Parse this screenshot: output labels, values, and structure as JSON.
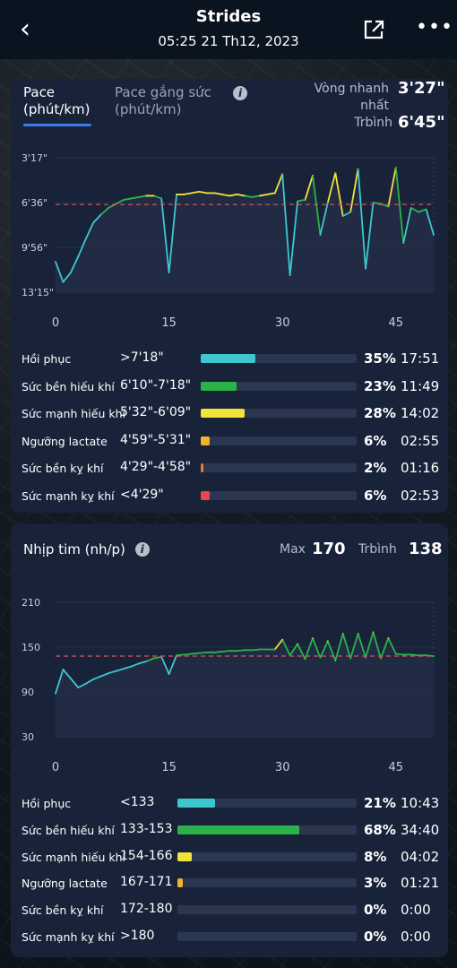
{
  "header": {
    "title": "Strides",
    "datetime": "05:25 21 Th12, 2023"
  },
  "pace": {
    "tab_active": "Pace (phút/km)",
    "tab_inactive": "Pace gắng sức (phút/km)",
    "fastest_label": "Vòng nhanh nhất",
    "fastest_value": "3'27\"",
    "avg_label": "Trbình",
    "avg_value": "6'45\"",
    "chart_y_ticks": [
      "3'17\"",
      "6'36\"",
      "9'56\"",
      "13'15\""
    ],
    "chart_x_ticks": [
      "0",
      "15",
      "30",
      "45"
    ],
    "zones": [
      {
        "name": "Hồi phục",
        "range": ">7'18\"",
        "percent": "35%",
        "time": "17:51",
        "fraction": 0.35,
        "color": "#3fc7cf"
      },
      {
        "name": "Sức bền hiếu khí",
        "range": "6'10\"-7'18\"",
        "percent": "23%",
        "time": "11:49",
        "fraction": 0.23,
        "color": "#2bb34a"
      },
      {
        "name": "Sức mạnh hiếu khí",
        "range": "5'32\"-6'09\"",
        "percent": "28%",
        "time": "14:02",
        "fraction": 0.28,
        "color": "#f1e33a"
      },
      {
        "name": "Ngưỡng lactate",
        "range": "4'59\"-5'31\"",
        "percent": "6%",
        "time": "02:55",
        "fraction": 0.06,
        "color": "#f3b12c"
      },
      {
        "name": "Sức bền kỵ khí",
        "range": "4'29\"-4'58\"",
        "percent": "2%",
        "time": "01:16",
        "fraction": 0.02,
        "color": "#ef7a32"
      },
      {
        "name": "Sức mạnh kỵ khí",
        "range": "<4'29\"",
        "percent": "6%",
        "time": "02:53",
        "fraction": 0.06,
        "color": "#e8474f"
      }
    ]
  },
  "hr": {
    "title": "Nhịp tim (nh/p)",
    "max_label": "Max",
    "max_value": "170",
    "avg_label": "Trbình",
    "avg_value": "138",
    "chart_y_ticks": [
      "210",
      "150",
      "90",
      "30"
    ],
    "chart_x_ticks": [
      "0",
      "15",
      "30",
      "45"
    ],
    "zones": [
      {
        "name": "Hồi phục",
        "range": "<133",
        "percent": "21%",
        "time": "10:43",
        "fraction": 0.21,
        "color": "#3fc7cf"
      },
      {
        "name": "Sức bền hiếu khí",
        "range": "133-153",
        "percent": "68%",
        "time": "34:40",
        "fraction": 0.68,
        "color": "#2bb34a"
      },
      {
        "name": "Sức mạnh hiếu khí",
        "range": "154-166",
        "percent": "8%",
        "time": "04:02",
        "fraction": 0.08,
        "color": "#f1e33a"
      },
      {
        "name": "Ngưỡng lactate",
        "range": "167-171",
        "percent": "3%",
        "time": "01:21",
        "fraction": 0.03,
        "color": "#f3b12c"
      },
      {
        "name": "Sức bền kỵ khí",
        "range": "172-180",
        "percent": "0%",
        "time": "0:00",
        "fraction": 0,
        "color": "#ef7a32"
      },
      {
        "name": "Sức mạnh kỵ khí",
        "range": ">180",
        "percent": "0%",
        "time": "0:00",
        "fraction": 0,
        "color": "#e8474f"
      }
    ]
  },
  "chart_data": [
    {
      "type": "line",
      "ylabel": "",
      "xlabel": "",
      "y_reversed": true,
      "y_ticks": [
        "3'17\"",
        "6'36\"",
        "9'56\"",
        "13'15\""
      ],
      "x_ticks": [
        0,
        15,
        30,
        45
      ],
      "average_line": "6'45\"",
      "series": [
        {
          "x": [
            0,
            1,
            2,
            3,
            4,
            5,
            6,
            7,
            8,
            9,
            10,
            11,
            12,
            13,
            14,
            15,
            16,
            17,
            18,
            19,
            20,
            21,
            22,
            23,
            24,
            25,
            26,
            27,
            28,
            29,
            30,
            31,
            32,
            33,
            34,
            35,
            36,
            37,
            38,
            39,
            40,
            41,
            42,
            43,
            44,
            45,
            46,
            47,
            48,
            49,
            50
          ],
          "y": [
            11.0,
            12.5,
            11.8,
            10.6,
            9.3,
            8.1,
            7.5,
            7.0,
            6.7,
            6.4,
            6.3,
            6.2,
            6.1,
            6.1,
            6.3,
            11.8,
            6.0,
            6.0,
            5.9,
            5.8,
            5.9,
            5.9,
            6.0,
            6.1,
            6.0,
            6.1,
            6.2,
            6.1,
            6.0,
            5.9,
            4.5,
            12.0,
            6.5,
            6.4,
            4.6,
            9.0,
            6.6,
            4.4,
            7.6,
            7.3,
            4.1,
            11.5,
            6.6,
            6.7,
            6.9,
            4.0,
            9.6,
            7.0,
            7.3,
            7.1,
            9.0
          ]
        }
      ]
    },
    {
      "type": "line",
      "ylabel": "",
      "xlabel": "",
      "y_ticks": [
        210,
        150,
        90,
        30
      ],
      "x_ticks": [
        0,
        15,
        30,
        45
      ],
      "ylim": [
        30,
        210
      ],
      "average_line": 138,
      "series": [
        {
          "x": [
            0,
            1,
            2,
            3,
            4,
            5,
            6,
            7,
            8,
            9,
            10,
            11,
            12,
            13,
            14,
            15,
            16,
            17,
            18,
            19,
            20,
            21,
            22,
            23,
            24,
            25,
            26,
            27,
            28,
            29,
            30,
            31,
            32,
            33,
            34,
            35,
            36,
            37,
            38,
            39,
            40,
            41,
            42,
            43,
            44,
            45,
            46,
            47,
            48,
            49,
            50
          ],
          "y": [
            88,
            120,
            108,
            96,
            101,
            107,
            111,
            115,
            118,
            121,
            124,
            128,
            131,
            135,
            137,
            114,
            139,
            140,
            141,
            142,
            143,
            143,
            144,
            145,
            145,
            146,
            146,
            147,
            147,
            147,
            160,
            139,
            154,
            134,
            162,
            136,
            158,
            132,
            168,
            135,
            168,
            136,
            170,
            135,
            162,
            141,
            140,
            140,
            139,
            139,
            138
          ]
        }
      ]
    }
  ]
}
